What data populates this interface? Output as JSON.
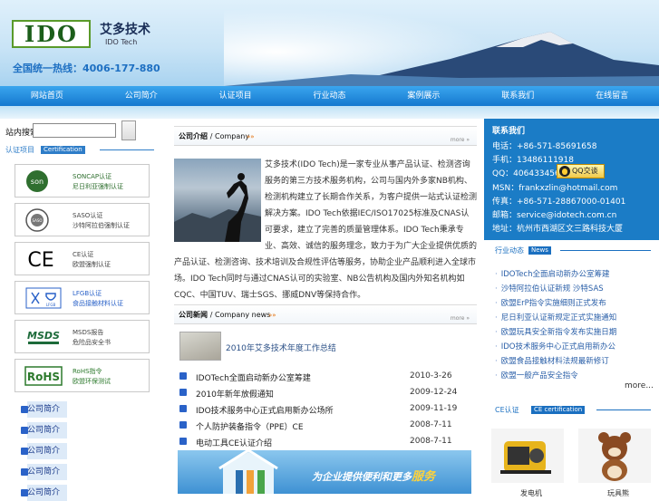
{
  "header": {
    "logo_text": "IDO",
    "brand_cn": "艾多技术",
    "brand_en": "IDO Tech",
    "hotline": "全国统一热线：4006-177-880"
  },
  "nav": [
    "网站首页",
    "公司简介",
    "认证项目",
    "行业动态",
    "案例展示",
    "联系我们",
    "在线留言"
  ],
  "left": {
    "search_label": "站内搜索",
    "cert_title_cn": "认证项目",
    "cert_title_en": "Certification",
    "certs": [
      {
        "icon": "son-logo",
        "mark": "son",
        "l1": "SONCAP认证",
        "l2": "尼日利亚强制认证"
      },
      {
        "icon": "saso-logo",
        "mark": "SASO",
        "l1": "SASO认证",
        "l2": "沙特阿拉伯强制认证"
      },
      {
        "icon": "ce-logo",
        "mark": "CE",
        "l1": "CE认证",
        "l2": "欧盟强制认证"
      },
      {
        "icon": "lfgb-logo",
        "mark": "LFGB",
        "l1": "LFGB认证",
        "l2": "食品接触材料认证"
      },
      {
        "icon": "msds-logo",
        "mark": "MSDS",
        "l1": "MSDS报告",
        "l2": "危险品安全书"
      },
      {
        "icon": "rohs-logo",
        "mark": "RoHS",
        "l1": "RoHS指令",
        "l2": "欧盟环保测试"
      }
    ],
    "nav_items": [
      "公司简介",
      "公司简介",
      "公司简介",
      "公司简介",
      "公司简介"
    ]
  },
  "center": {
    "intro_title": "公司介绍",
    "intro_title_en": "/ Company",
    "more": "more »",
    "intro_text": "艾多技术(IDO Tech)是一家专业从事产品认证、检测咨询服务的第三方技术服务机构，公司与国内外多家NB机构、检测机构建立了长期合作关系，为客户提供一站式认证检测解决方案。IDO Tech依据IEC/ISO17025标准及CNAS认可要求，建立了完善的质量管理体系。IDO Tech秉承专业、高效、诚信的服务理念，致力于为广大企业提供优质的产品认证、检测咨询、技术培训及合规性评估等服务，协助企业产品顺利进入全球市场。IDO Tech同时与通过CNAS认可的实验室、NB公告机构及国内外知名机构如CQC、中国TUV、瑞士SGS、挪威DNV等保持合作。",
    "news_title": "公司新闻",
    "news_title_en": "/ Company news",
    "featured": "2010年艾多技术年度工作总结",
    "news": [
      {
        "title": "IDOTech全面启动新办公室筹建",
        "date": "2010-3-26"
      },
      {
        "title": "2010年新年放假通知",
        "date": "2009-12-24"
      },
      {
        "title": "IDO技术服务中心正式启用新办公场所",
        "date": "2009-11-19"
      },
      {
        "title": "个人防护装备指令（PPE）CE",
        "date": "2008-7-11"
      },
      {
        "title": "电动工具CE认证介绍",
        "date": "2008-7-11"
      }
    ],
    "banner_text": "为企业提供便利和更多",
    "banner_emph": "服务"
  },
  "right": {
    "contact_title": "联系我们",
    "contact": [
      "电话：+86-571-85691658",
      "手机：13486111918",
      "QQ：406433456",
      "MSN：frankxzlin@hotmail.com",
      "传真：+86-571-28867000-01401",
      "邮箱：service@idotech.com.cn",
      "地址：杭州市西湖区文三路科技大厦"
    ],
    "qq_label": "QQ交谈",
    "news_title_cn": "行业动态",
    "news_title_en": "News",
    "news": [
      "IDOTech全面启动新办公室筹建",
      "沙特阿拉伯认证新规 沙特SAS",
      "欧盟ErP指令实施细则正式发布",
      "尼日利亚认证新规定正式实施通知",
      "欧盟玩具安全新指令发布实施日期",
      "IDO技术服务中心正式启用新办公",
      "欧盟食品接触材料法规最新修订",
      "欧盟一般产品安全指令"
    ],
    "more": "more...",
    "ce_title_cn": "CE认证",
    "ce_title_en": "CE certification",
    "ce_captions": [
      "发电机",
      "玩具熊"
    ]
  }
}
